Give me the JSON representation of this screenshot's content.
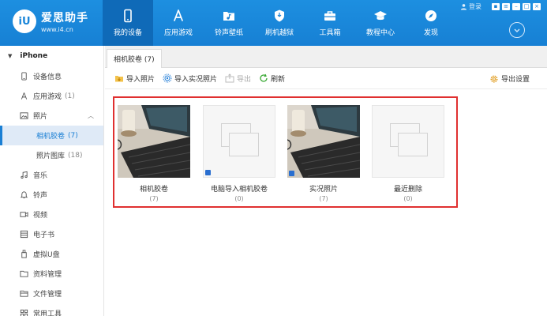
{
  "app": {
    "name": "爱思助手",
    "url": "www.i4.cn",
    "logo_text": "iU"
  },
  "nav": [
    {
      "label": "我的设备",
      "icon": "phone-icon",
      "active": true
    },
    {
      "label": "应用游戏",
      "icon": "app-store-icon"
    },
    {
      "label": "铃声壁纸",
      "icon": "music-folder-icon"
    },
    {
      "label": "刷机越狱",
      "icon": "shield-icon"
    },
    {
      "label": "工具箱",
      "icon": "toolbox-icon"
    },
    {
      "label": "教程中心",
      "icon": "graduation-cap-icon"
    },
    {
      "label": "发现",
      "icon": "compass-icon"
    }
  ],
  "window": {
    "login": "登录"
  },
  "sidebar": {
    "device": "iPhone",
    "items": [
      {
        "label": "设备信息",
        "icon": "device-info-icon"
      },
      {
        "label": "应用游戏",
        "count": "(1)",
        "icon": "app-store-icon"
      },
      {
        "label": "照片",
        "icon": "photo-icon"
      },
      {
        "label": "相机胶卷",
        "count": "(7)"
      },
      {
        "label": "照片图库",
        "count": "(18)"
      },
      {
        "label": "音乐",
        "icon": "music-icon"
      },
      {
        "label": "铃声",
        "icon": "bell-icon"
      },
      {
        "label": "视频",
        "icon": "video-icon"
      },
      {
        "label": "电子书",
        "icon": "ebook-icon"
      },
      {
        "label": "虚拟U盘",
        "icon": "usb-icon"
      },
      {
        "label": "资料管理",
        "icon": "folder-icon"
      },
      {
        "label": "文件管理",
        "icon": "file-icon"
      },
      {
        "label": "常用工具",
        "icon": "grid-icon"
      }
    ]
  },
  "tab": {
    "label": "相机胶卷 (7)"
  },
  "toolbar": {
    "import_photos": "导入照片",
    "import_live": "导入实况照片",
    "export": "导出",
    "refresh": "刷新",
    "export_settings": "导出设置"
  },
  "albums": [
    {
      "name": "相机胶卷",
      "count": "(7)"
    },
    {
      "name": "电脑导入相机胶卷",
      "count": "(0)"
    },
    {
      "name": "实况照片",
      "count": "(7)"
    },
    {
      "name": "最近删除",
      "count": "(0)"
    }
  ],
  "colors": {
    "topbar": "#1780d4",
    "nav_active": "#0f6ab8",
    "accent": "#1a7fd4",
    "highlight_border": "#e03030"
  }
}
